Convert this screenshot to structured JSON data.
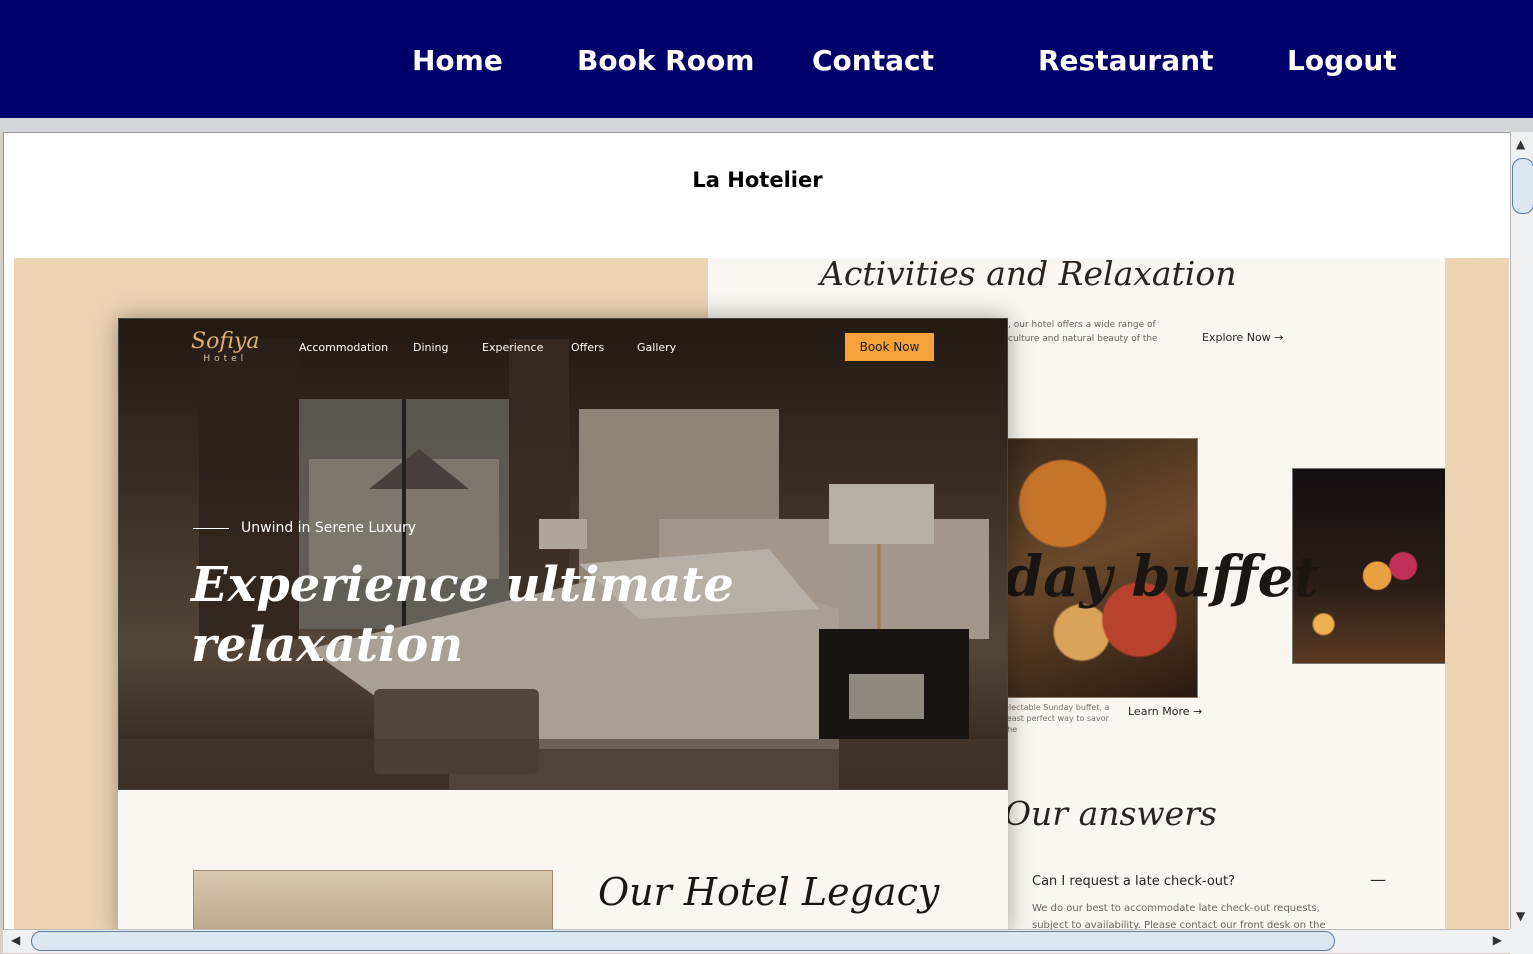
{
  "nav": {
    "items": [
      {
        "label": "Home"
      },
      {
        "label": "Book Room"
      },
      {
        "label": "Contact"
      },
      {
        "label": "Restaurant"
      },
      {
        "label": "Logout"
      }
    ]
  },
  "frame": {
    "title": "La Hotelier"
  },
  "preview": {
    "hero": {
      "logo_name": "Sofiya",
      "logo_sub": "Hotel",
      "menu": [
        "Accommodation",
        "Dining",
        "Experience",
        "Offers",
        "Gallery"
      ],
      "book_button": "Book Now",
      "tagline": "Unwind in Serene Luxury",
      "title": "Experience ultimate relaxation"
    },
    "legacy_title": "Our Hotel Legacy",
    "activities": {
      "title": "Activities and Relaxation",
      "text": ", our hotel offers a wide range of culture and natural beauty of the",
      "link": "Explore Now →"
    },
    "buffet": {
      "title": "day buffet",
      "text": "electable Sunday buffet, a feast perfect way to savor the",
      "link": "Learn More →"
    },
    "faq": {
      "title": "Our answers",
      "question": "Can I request a late check-out?",
      "toggle": "—",
      "answer": "We do our best to accommodate late check-out requests, subject to availability. Please contact our front desk on the day of your"
    }
  },
  "scrollbars": {
    "up": "▲",
    "down": "▼",
    "left": "◀",
    "right": "▶"
  },
  "colors": {
    "nav_bg": "#00006b",
    "accent_button": "#f5a23a",
    "backdrop": "#ecd3b4"
  }
}
